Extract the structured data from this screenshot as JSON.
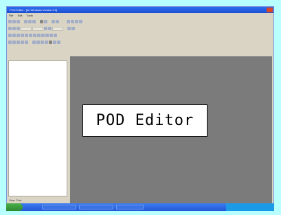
{
  "window": {
    "title": "POD Editor - [for Windows Version 2.0]"
  },
  "menubar": {
    "items": [
      "File",
      "Edit",
      "Tools"
    ]
  },
  "side_panel": {
    "tabs": [
      "View",
      "Find"
    ]
  },
  "overlay_label": {
    "text": "POD Editor"
  }
}
